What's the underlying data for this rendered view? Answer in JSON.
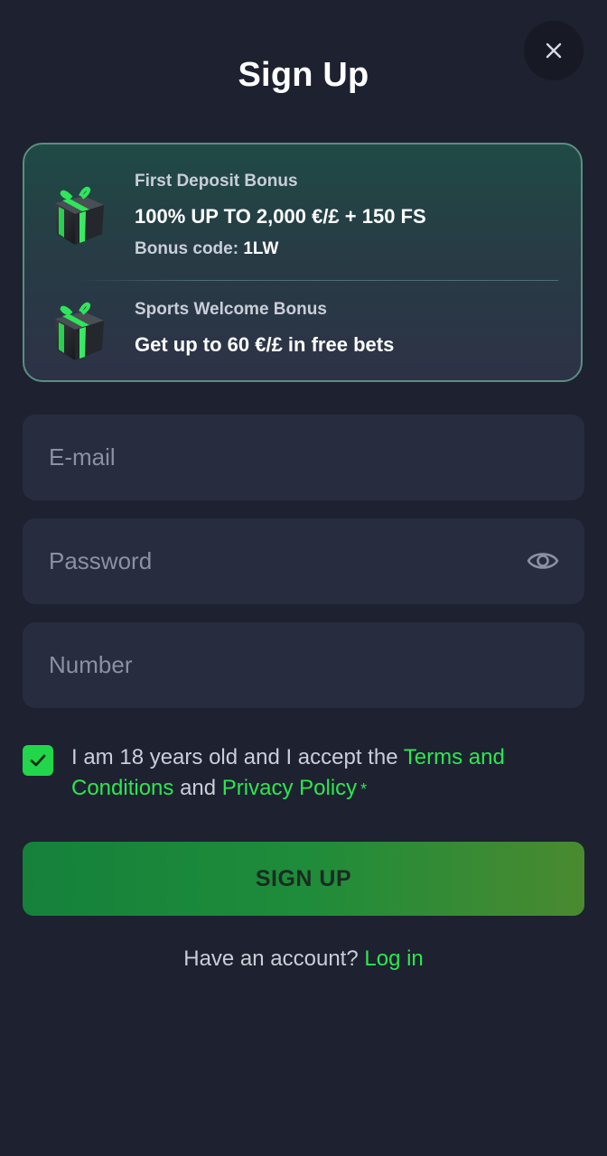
{
  "header": {
    "title": "Sign Up",
    "close_icon": "close-icon"
  },
  "bonuses": [
    {
      "kicker": "First Deposit Bonus",
      "headline": "100% UP TO 2,000 €/£ + 150 FS",
      "code_label": "Bonus code:",
      "code_value": "1LW",
      "icon": "gift-icon"
    },
    {
      "kicker": "Sports Welcome Bonus",
      "headline": "Get up to 60 €/£ in free bets",
      "icon": "gift-icon"
    }
  ],
  "form": {
    "email_placeholder": "E-mail",
    "password_placeholder": "Password",
    "number_placeholder": "Number",
    "password_toggle_icon": "eye-icon"
  },
  "consent": {
    "checked": true,
    "text_prefix": "I am 18 years old and I accept the",
    "terms_link": "Terms and Conditions",
    "text_middle": "and",
    "privacy_link": "Privacy Policy",
    "required_mark": "*"
  },
  "signup_button": "SIGN UP",
  "login": {
    "prompt": "Have an account?",
    "link": "Log in"
  },
  "colors": {
    "background": "#1d2130",
    "field": "#272c3e",
    "accent_green": "#2be84f",
    "checkbox_green": "#21d64a"
  }
}
